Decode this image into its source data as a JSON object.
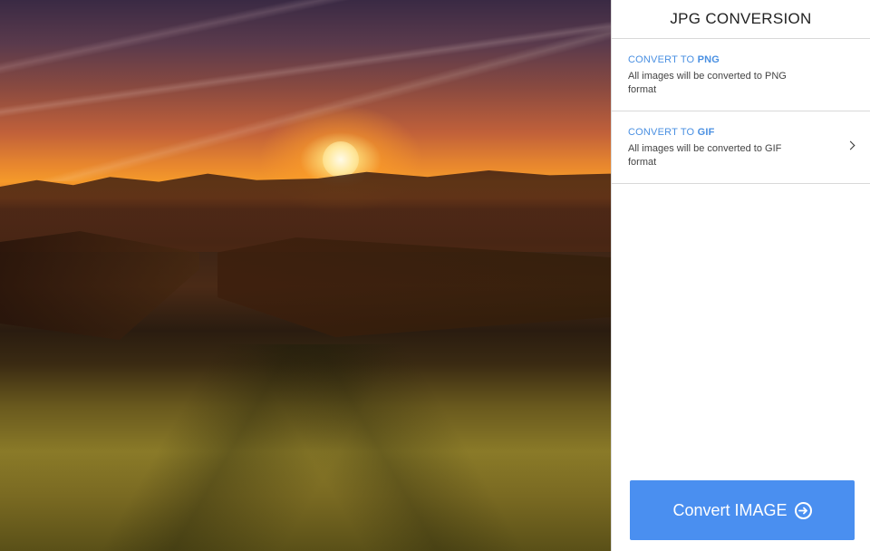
{
  "panel": {
    "title": "JPG CONVERSION",
    "options": [
      {
        "heading_prefix": "CONVERT TO ",
        "heading_format": "PNG",
        "description": "All images will be converted to PNG format"
      },
      {
        "heading_prefix": "CONVERT TO ",
        "heading_format": "GIF",
        "description": "All images will be converted to GIF format"
      }
    ],
    "convert_button_label": "Convert IMAGE"
  },
  "icons": {
    "chevron": "chevron-right-icon",
    "convert": "arrow-right-circle-icon"
  },
  "colors": {
    "accent": "#4a8ff0",
    "heading": "#4a90e2"
  }
}
